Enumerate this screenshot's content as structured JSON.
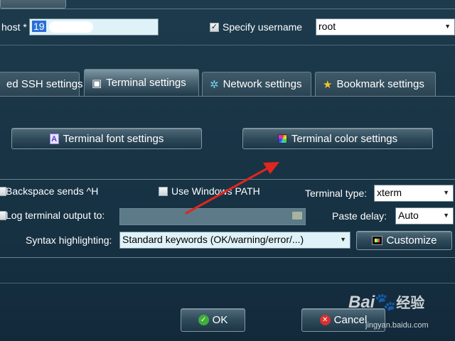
{
  "session": {
    "host_label": "host *",
    "host_value": "19",
    "specify_username_label": "Specify username",
    "specify_username_checked": true,
    "username_value": "root"
  },
  "tabs": [
    {
      "label": "ed SSH settings",
      "icon": "none",
      "active": false
    },
    {
      "label": "Terminal settings",
      "icon": "terminal-icon",
      "active": true
    },
    {
      "label": "Network settings",
      "icon": "network-icon",
      "active": false
    },
    {
      "label": "Bookmark settings",
      "icon": "star-icon",
      "active": false
    }
  ],
  "terminal": {
    "font_button": "Terminal font settings",
    "color_button": "Terminal color settings",
    "backspace_label": "Backspace sends ^H",
    "windows_path_label": "Use Windows PATH",
    "windows_path_checked": false,
    "terminal_type_label": "Terminal type:",
    "terminal_type_value": "xterm",
    "log_output_label": "Log terminal output to:",
    "log_output_value": "",
    "paste_delay_label": "Paste delay:",
    "paste_delay_value": "Auto",
    "syntax_label": "Syntax highlighting:",
    "syntax_value": "Standard keywords (OK/warning/error/...)",
    "customize_button": "Customize"
  },
  "footer": {
    "ok_button": "OK",
    "cancel_button": "Cancel"
  },
  "watermark": {
    "brand": "Bai",
    "brand_tail": "经验",
    "url": "jingyan.baidu.com"
  },
  "colors": {
    "background": "#193546",
    "annotation_arrow": "#e0261e",
    "field_bg": "#dff2f8"
  }
}
